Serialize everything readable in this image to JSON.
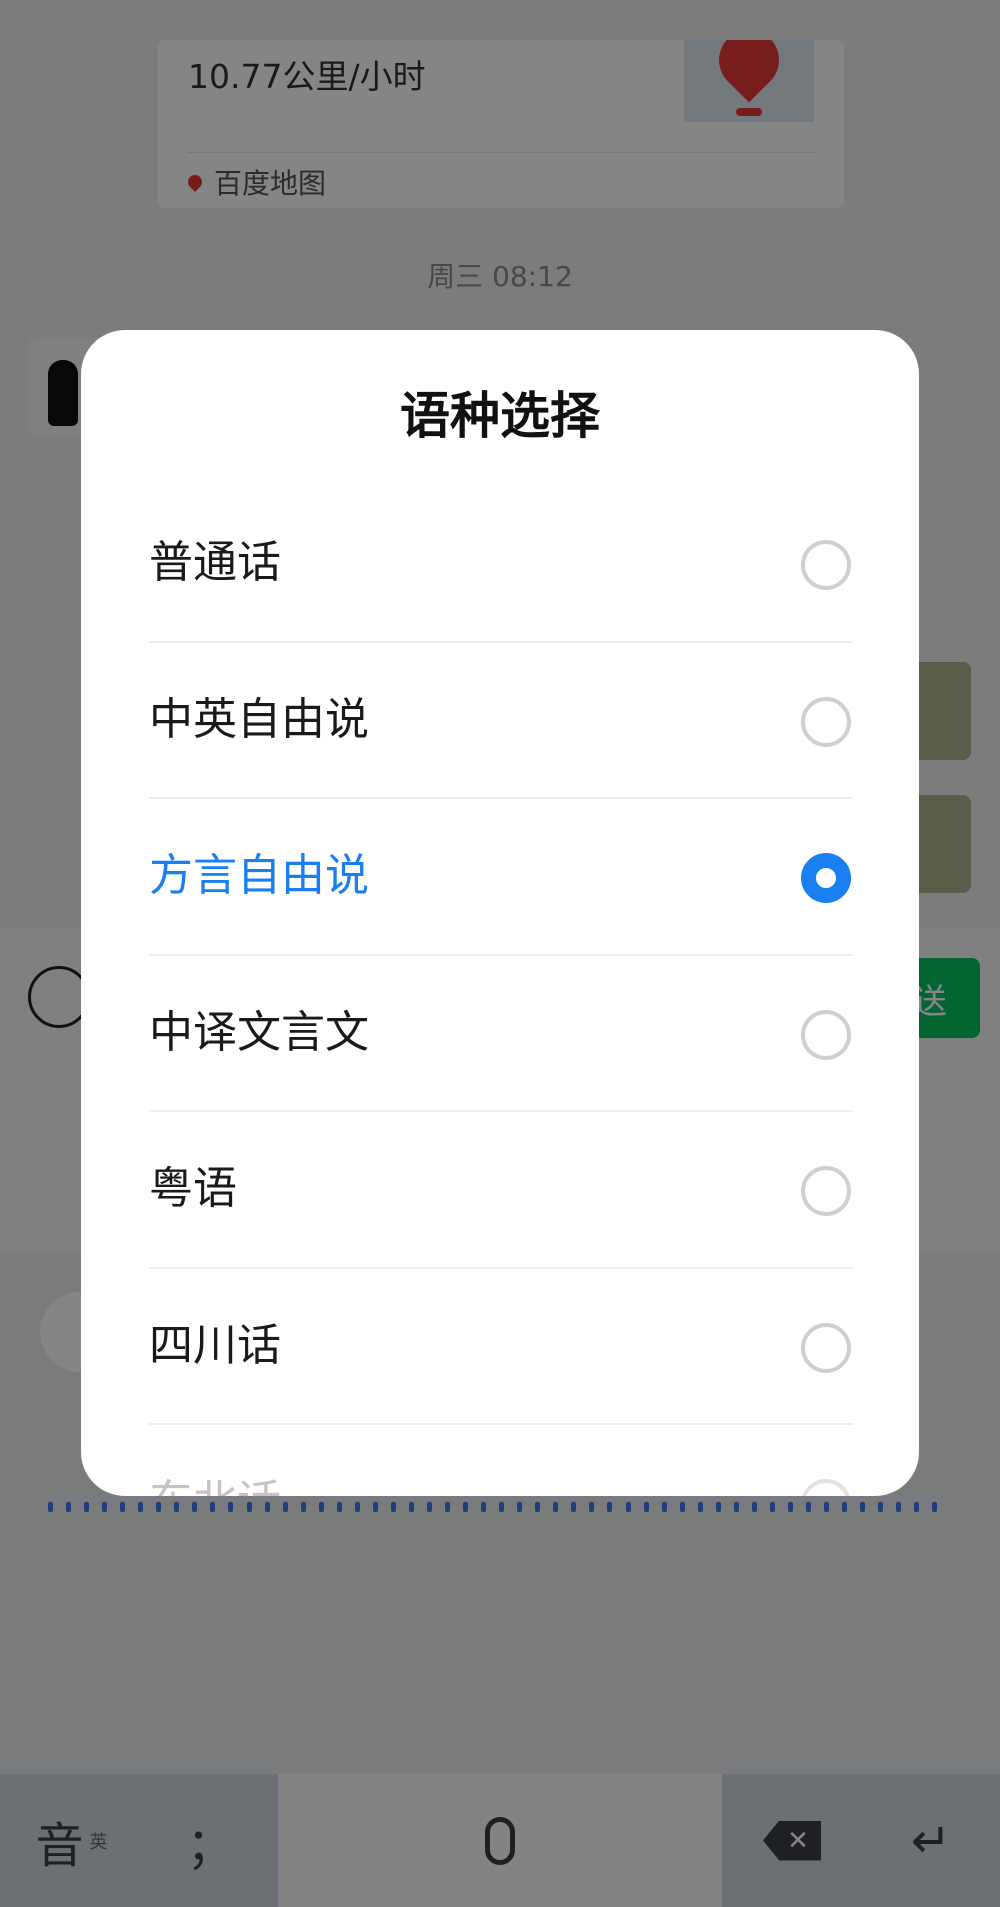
{
  "background": {
    "location_card": {
      "speed_text": "10.77公里/小时",
      "source_label": "百度地图"
    },
    "chat_timestamp": "周三 08:12",
    "send_button_label": "送"
  },
  "dialog": {
    "title": "语种选择",
    "options": [
      {
        "label": "普通话",
        "selected": false
      },
      {
        "label": "中英自由说",
        "selected": false
      },
      {
        "label": "方言自由说",
        "selected": true
      },
      {
        "label": "中译文言文",
        "selected": false
      },
      {
        "label": "粤语",
        "selected": false
      },
      {
        "label": "四川话",
        "selected": false
      },
      {
        "label": "东北话",
        "selected": false
      }
    ]
  },
  "keyboard": {
    "mode_key": "音",
    "mode_sub": "英",
    "punct_key": "；",
    "backspace_symbol": "✕",
    "enter_symbol": "↵"
  },
  "colors": {
    "accent": "#1a7ff0",
    "send_green": "#07c160"
  },
  "icons": {
    "voice": "voice-wave-icon",
    "mic": "microphone-icon",
    "backspace": "backspace-icon",
    "enter": "enter-icon",
    "pin": "map-pin-icon"
  }
}
